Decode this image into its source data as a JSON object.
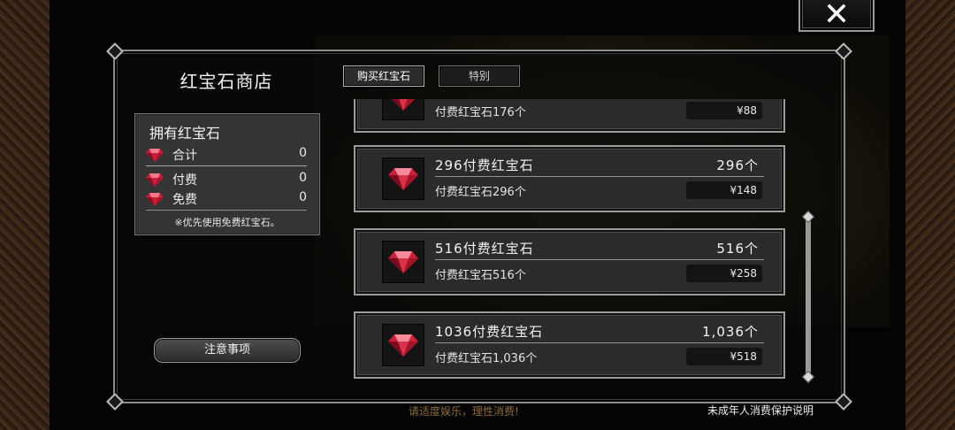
{
  "shop": {
    "title": "红宝石商店",
    "tabs": [
      {
        "label": "购买红宝石",
        "active": true
      },
      {
        "label": "特别",
        "active": false
      }
    ]
  },
  "owned": {
    "title": "拥有红宝石",
    "rows": [
      {
        "label": "合计",
        "value": "0"
      },
      {
        "label": "付费",
        "value": "0"
      },
      {
        "label": "免费",
        "value": "0"
      }
    ],
    "note": "※优先使用免费红宝石。"
  },
  "notice_button": "注意事项",
  "products": [
    {
      "name": "",
      "count": "",
      "sub": "付费红宝石176个",
      "price": "¥88"
    },
    {
      "name": "296付费红宝石",
      "count": "296个",
      "sub": "付费红宝石296个",
      "price": "¥148"
    },
    {
      "name": "516付费红宝石",
      "count": "516个",
      "sub": "付费红宝石516个",
      "price": "¥258"
    },
    {
      "name": "1036付费红宝石",
      "count": "1,036个",
      "sub": "付费红宝石1,036个",
      "price": "¥518"
    }
  ],
  "footer": {
    "left": "请适度娱乐，理性消费!",
    "right": "未成年人消费保护说明"
  },
  "colors": {
    "gem": "#c8203a",
    "footer_left": "#8d6c3a"
  },
  "icons": {
    "close": "close-icon",
    "gem": "ruby-gem-icon"
  }
}
